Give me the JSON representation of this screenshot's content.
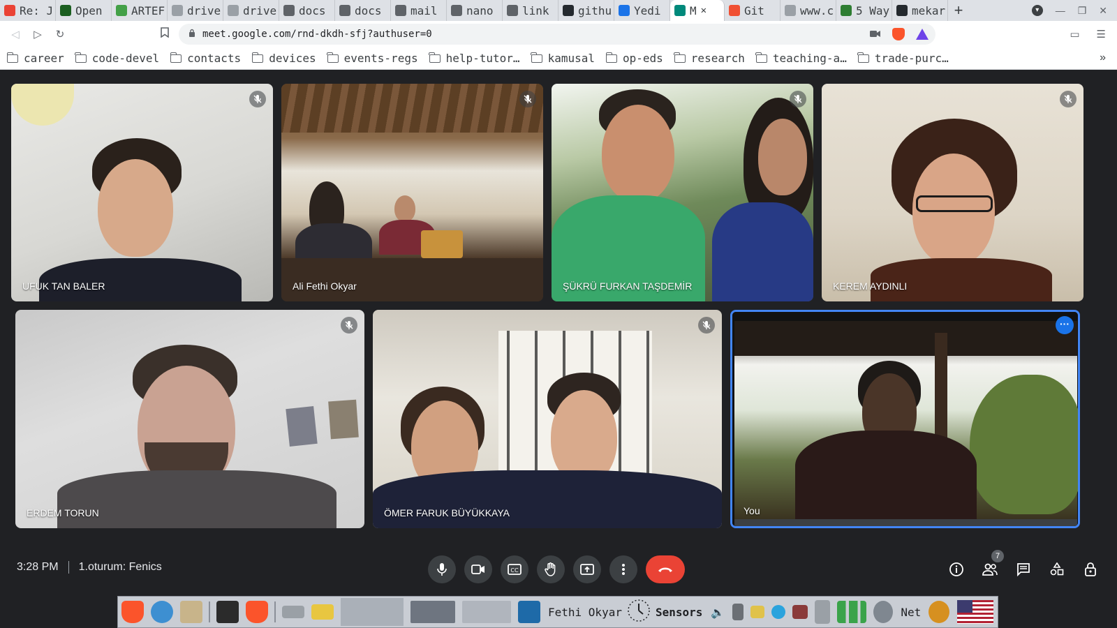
{
  "browser": {
    "tabs": [
      {
        "label": "Re: J",
        "color": "#ea4335"
      },
      {
        "label": "Open",
        "color": "#1b5e20"
      },
      {
        "label": "ARTEF",
        "color": "#43a047"
      },
      {
        "label": "drive",
        "color": "#9aa0a6"
      },
      {
        "label": "drive",
        "color": "#9aa0a6"
      },
      {
        "label": "docs",
        "color": "#5f6368"
      },
      {
        "label": "docs",
        "color": "#5f6368"
      },
      {
        "label": "mail",
        "color": "#5f6368"
      },
      {
        "label": "nano",
        "color": "#5f6368"
      },
      {
        "label": "link",
        "color": "#5f6368"
      },
      {
        "label": "githu",
        "color": "#24292e"
      },
      {
        "label": "Yedi",
        "color": "#1a73e8"
      },
      {
        "label": "M",
        "color": "#00897b"
      },
      {
        "label": "Git",
        "color": "#f05033"
      },
      {
        "label": "www.c",
        "color": "#9aa0a6"
      },
      {
        "label": "5 Way",
        "color": "#2e7d32"
      },
      {
        "label": "mekar",
        "color": "#24292e"
      }
    ],
    "active_tab_index": 12,
    "new_tab_symbol": "+",
    "url": "meet.google.com/rnd-dkdh-sfj?authuser=0",
    "bookmarks": [
      "career",
      "code-devel",
      "contacts",
      "devices",
      "events-regs",
      "help-tutor…",
      "kamusal",
      "op-eds",
      "research",
      "teaching-a…",
      "trade-purc…"
    ],
    "bookmarks_more": "»"
  },
  "meet": {
    "participants": [
      {
        "name": "UFUK TAN BALER",
        "muted": true
      },
      {
        "name": "Ali Fethi Okyar",
        "muted": true
      },
      {
        "name": "ŞÜKRÜ FURKAN TAŞDEMİR",
        "muted": true
      },
      {
        "name": "KEREM AYDINLI",
        "muted": true
      },
      {
        "name": "ERDEM TORUN",
        "muted": true
      },
      {
        "name": "ÖMER FARUK BÜYÜKKAYA",
        "muted": true
      },
      {
        "name": "You",
        "muted": false
      }
    ],
    "time": "3:28 PM",
    "meeting_title": "1.oturum: Fenics",
    "participant_count": "7",
    "accent": "#4285f4",
    "hangup_color": "#ea4335"
  },
  "taskbar": {
    "window_label": "Fethi Okyar",
    "sensors_label": "Sensors",
    "net_label": "Net"
  }
}
